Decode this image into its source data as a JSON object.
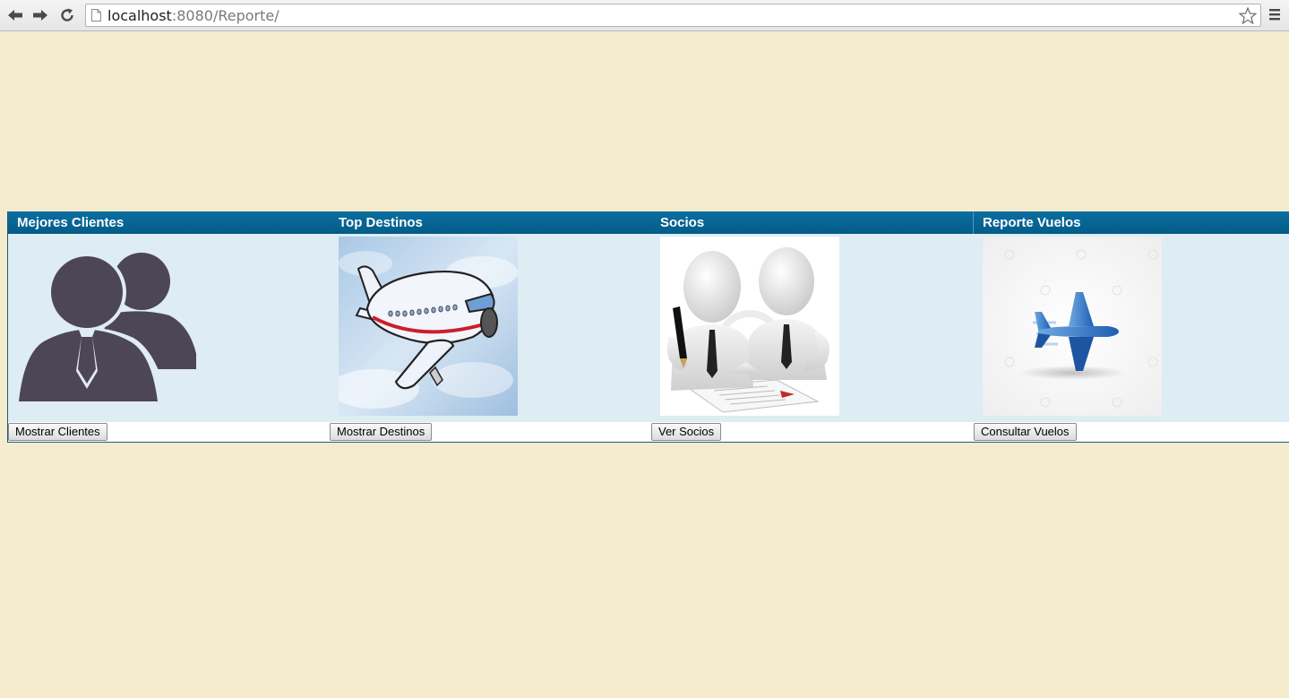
{
  "browser": {
    "url_host": "localhost",
    "url_rest": ":8080/Reporte/",
    "icons": [
      "back-icon",
      "forward-icon",
      "reload-icon",
      "page-icon",
      "star-icon",
      "menu-icon"
    ]
  },
  "report": {
    "colors": {
      "page_background": "#f5ebcd",
      "header_background": "#045c88",
      "body_background": "#deecf4",
      "clients_icon": "#4d4655"
    },
    "columns": [
      {
        "title": "Mejores Clientes",
        "button": "Mostrar Clientes",
        "image": "clients-people-icon"
      },
      {
        "title": "Top Destinos",
        "button": "Mostrar Destinos",
        "image": "cartoon-airplane-image"
      },
      {
        "title": "Socios",
        "button": "Ver Socios",
        "image": "business-partners-image"
      },
      {
        "title": "Reporte Vuelos",
        "button": "Consultar Vuelos",
        "image": "blue-airplane-image"
      }
    ]
  }
}
